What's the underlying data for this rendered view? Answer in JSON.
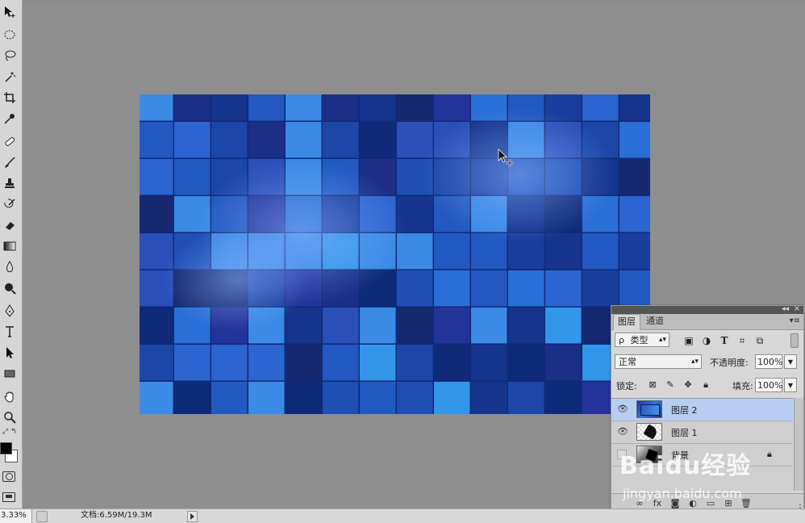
{
  "toolbar": {
    "tools": [
      {
        "name": "move-tool-icon"
      },
      {
        "name": "elliptical-marquee-icon"
      },
      {
        "name": "lasso-icon"
      },
      {
        "name": "magic-wand-icon"
      },
      {
        "name": "crop-icon"
      },
      {
        "name": "eyedropper-icon"
      },
      {
        "name": "spot-healing-icon"
      },
      {
        "name": "brush-icon"
      },
      {
        "name": "clone-stamp-icon"
      },
      {
        "name": "history-brush-icon"
      },
      {
        "name": "eraser-icon"
      },
      {
        "name": "gradient-icon"
      },
      {
        "name": "blur-icon"
      },
      {
        "name": "dodge-icon"
      },
      {
        "name": "pen-icon"
      },
      {
        "name": "type-icon"
      },
      {
        "name": "path-selection-icon"
      },
      {
        "name": "rectangle-icon"
      },
      {
        "name": "hand-icon"
      },
      {
        "name": "zoom-icon"
      }
    ],
    "foreground_color": "#000000",
    "background_color": "#ffffff"
  },
  "canvas": {
    "base_color": "#0f2a78"
  },
  "status": {
    "zoom": "3.33%",
    "doc_info": "文档:6.59M/19.3M"
  },
  "layers_panel": {
    "tabs": [
      "图层",
      "通道"
    ],
    "filter_label": "类型",
    "filter_prefix": "ρ",
    "blend_mode": "正常",
    "opacity_label": "不透明度:",
    "opacity_value": "100%",
    "lock_label": "锁定:",
    "fill_label": "填充:",
    "fill_value": "100%",
    "layers": [
      {
        "name": "图层 2",
        "visible": true,
        "selected": true,
        "locked": false
      },
      {
        "name": "图层 1",
        "visible": true,
        "selected": false,
        "locked": false
      },
      {
        "name": "背景",
        "visible": false,
        "selected": false,
        "locked": true
      }
    ]
  },
  "watermark": {
    "logo": "Baidu经验",
    "url": "jingyan.baidu.com"
  }
}
